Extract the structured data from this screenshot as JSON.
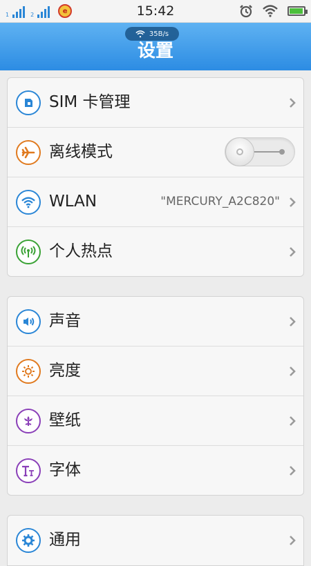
{
  "status_bar": {
    "time": "15:42",
    "sim1": "1",
    "sim2": "2",
    "carrier_glyph": "e",
    "icons": [
      "signal-icon",
      "signal-icon",
      "carrier-icon",
      "alarm-icon",
      "wifi-icon",
      "battery-icon"
    ],
    "battery_level_pct": 85
  },
  "header": {
    "title": "设置",
    "speed": "35B/s"
  },
  "groups": [
    {
      "items": [
        {
          "label": "SIM 卡管理",
          "icon": "sim-card-icon",
          "color": "#2a86d6"
        },
        {
          "label": "离线模式",
          "icon": "airplane-icon",
          "color": "#e07a1f",
          "toggle": "off"
        },
        {
          "label": "WLAN",
          "value": "\"MERCURY_A2C820\"",
          "icon": "wifi-icon",
          "color": "#2a86d6"
        },
        {
          "label": "个人热点",
          "icon": "hotspot-icon",
          "color": "#3aa235"
        }
      ]
    },
    {
      "items": [
        {
          "label": "声音",
          "icon": "speaker-icon",
          "color": "#2a86d6"
        },
        {
          "label": "亮度",
          "icon": "brightness-icon",
          "color": "#e07a1f"
        },
        {
          "label": "壁纸",
          "icon": "wallpaper-flower-icon",
          "color": "#8a3fb8"
        },
        {
          "label": "字体",
          "icon": "font-icon",
          "color": "#8a3fb8"
        }
      ]
    },
    {
      "items": [
        {
          "label": "通用",
          "icon": "gear-icon",
          "color": "#2a86d6"
        }
      ]
    }
  ]
}
